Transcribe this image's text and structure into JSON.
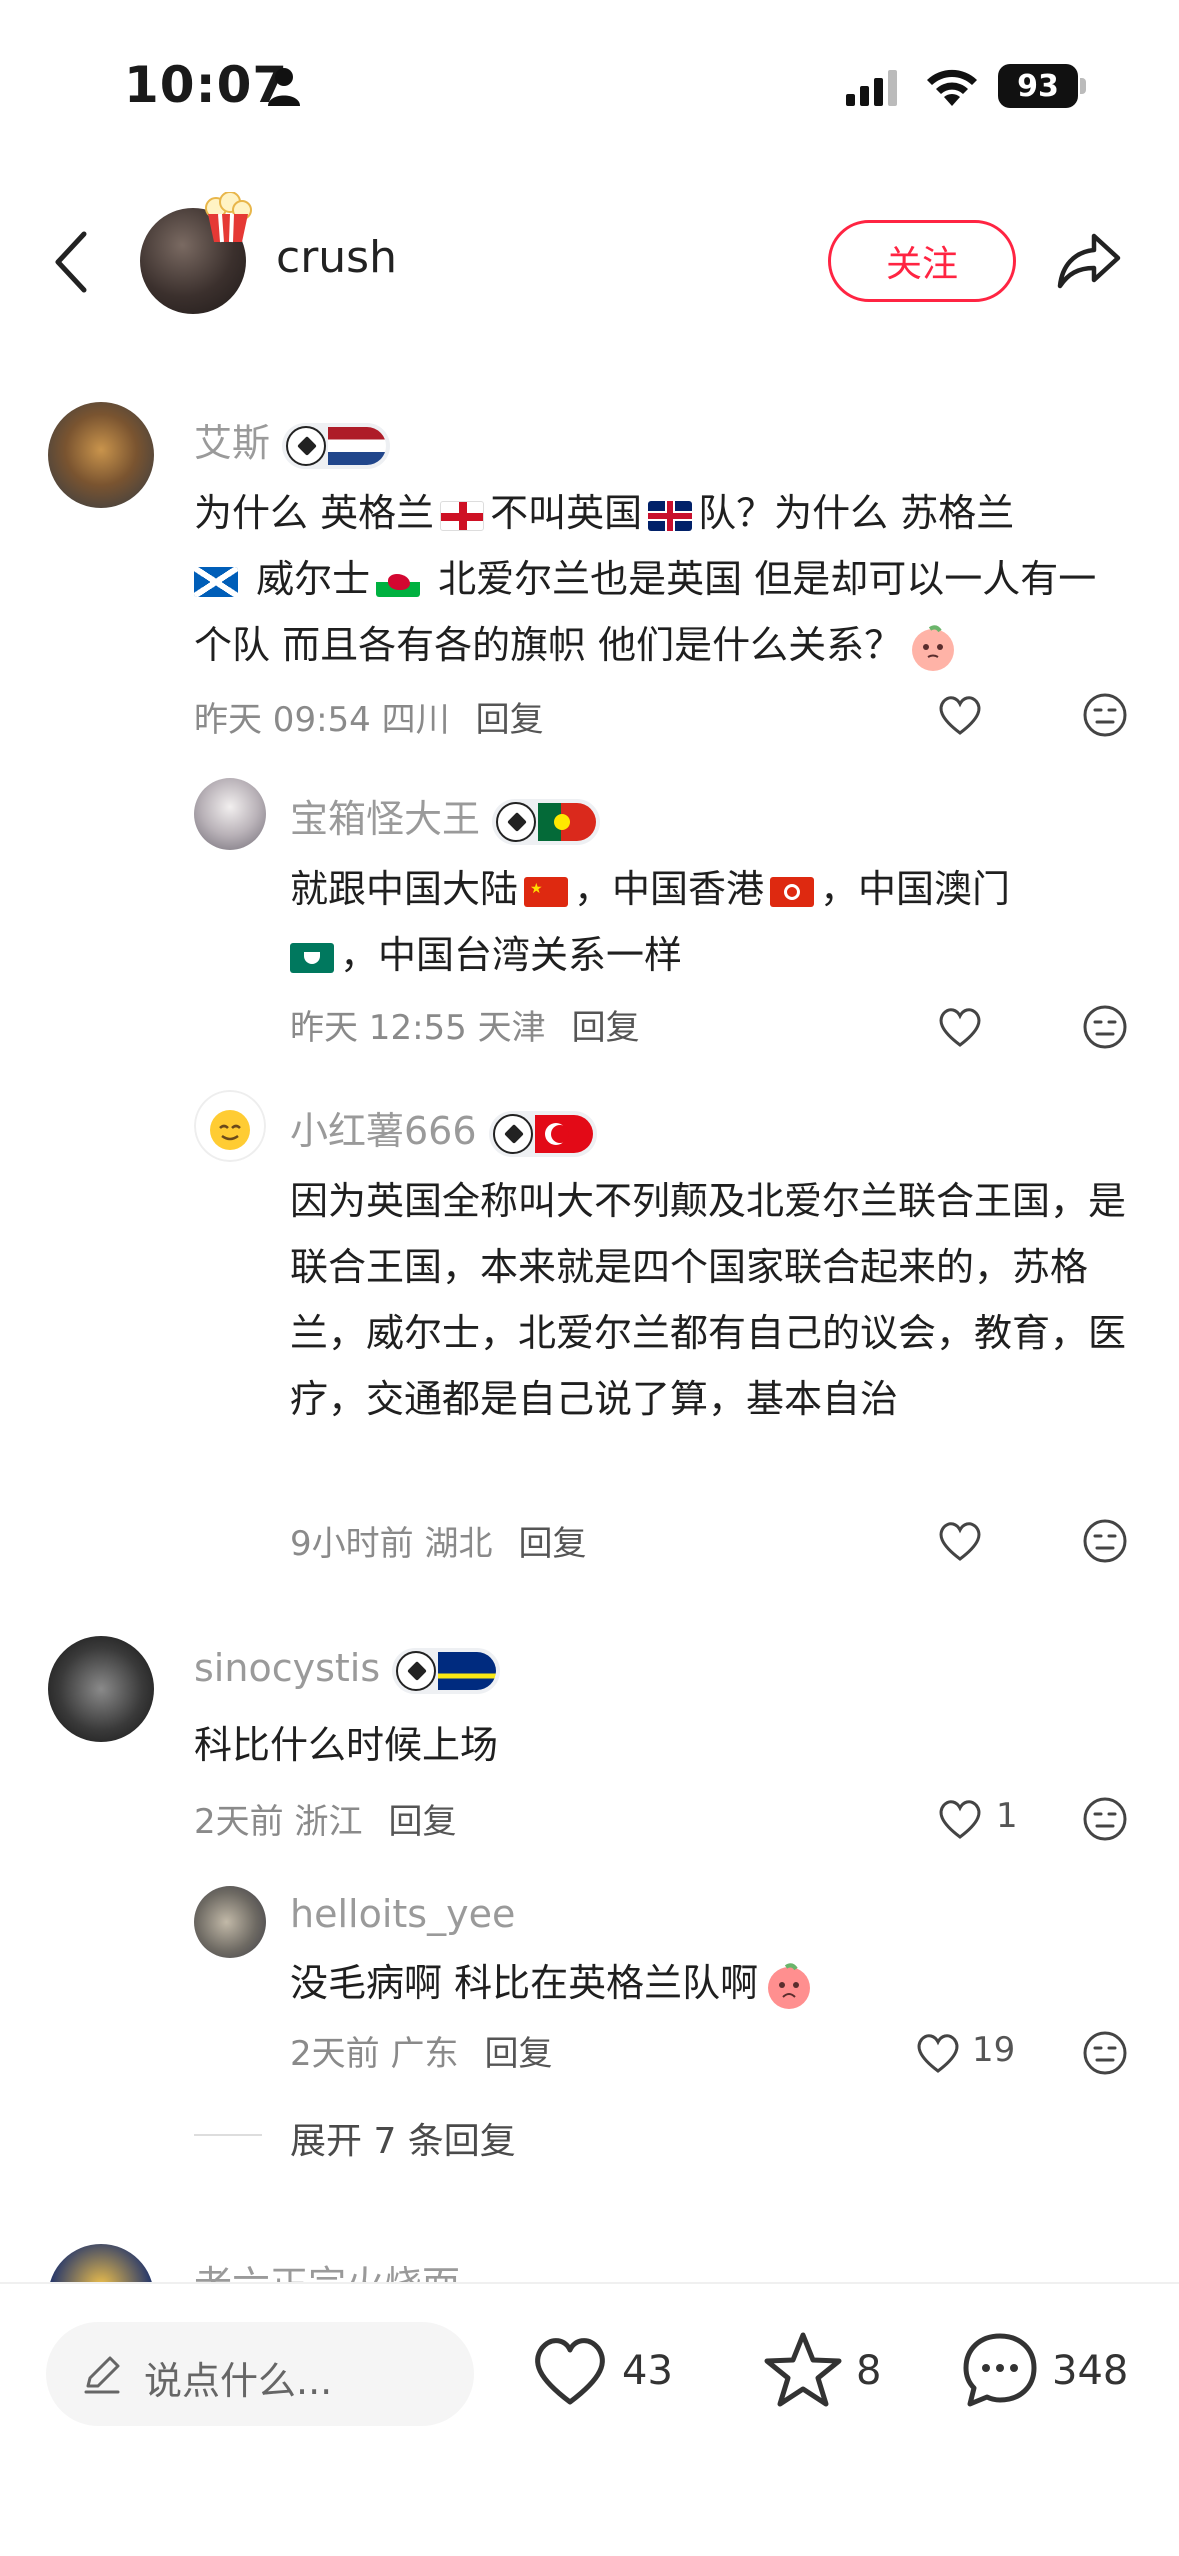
{
  "status_bar": {
    "time": "10:07",
    "battery": "93"
  },
  "header": {
    "author": "crush",
    "follow_label": "关注"
  },
  "comments": [
    {
      "name": "艾斯",
      "text_parts": [
        "为什么 英格兰",
        "不叫英国",
        "队？为什么 苏格兰",
        " 威尔士",
        " 北爱尔兰也是英国 但是却可以一人有一个队 而且各有各的旗帜 他们是什么关系？"
      ],
      "time": "昨天 09:54 四川",
      "reply_label": "回复"
    },
    {
      "name": "宝箱怪大王",
      "text_parts": [
        "就跟中国大陆",
        "，中国香港",
        "，中国澳门",
        "，中国台湾关系一样"
      ],
      "time": "昨天 12:55 天津",
      "reply_label": "回复"
    },
    {
      "name": "小红薯666",
      "text": "因为英国全称叫大不列颠及北爱尔兰联合王国，是联合王国，本来就是四个国家联合起来的，苏格兰，威尔士，北爱尔兰都有自己的议会，教育，医疗，交通都是自己说了算，基本自治",
      "time": "9小时前 湖北",
      "reply_label": "回复"
    },
    {
      "name": "sinocystis",
      "text": "科比什么时候上场",
      "time": "2天前 浙江",
      "reply_label": "回复",
      "likes": "1"
    },
    {
      "name": "helloits_yee",
      "text": "没毛病啊 科比在英格兰队啊",
      "time": "2天前 广东",
      "reply_label": "回复",
      "likes": "19"
    }
  ],
  "expand_replies": "展开 7 条回复",
  "partial_comment_name": "老六正宗火烧面",
  "bottom_bar": {
    "input_placeholder": "说点什么...",
    "likes": "43",
    "favorites": "8",
    "comments": "348"
  },
  "colors": {
    "accent": "#ff2442",
    "muted": "#9a9a9a"
  }
}
